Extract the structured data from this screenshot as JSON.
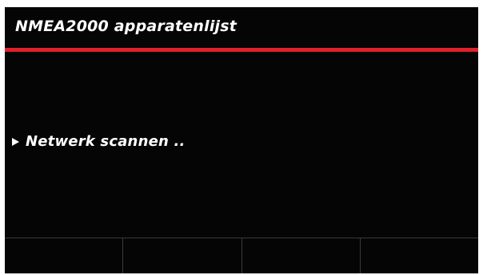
{
  "header": {
    "title": "NMEA2000 apparatenlijst"
  },
  "status": {
    "scan_text": "Netwerk scannen .."
  },
  "softkeys": [
    {
      "label": ""
    },
    {
      "label": ""
    },
    {
      "label": ""
    },
    {
      "label": ""
    }
  ],
  "colors": {
    "background": "#050505",
    "accent": "#e0212b",
    "text": "#ffffff",
    "divider": "#3a3a3a"
  },
  "icons": {
    "scan_indicator": "play-arrow-icon"
  }
}
